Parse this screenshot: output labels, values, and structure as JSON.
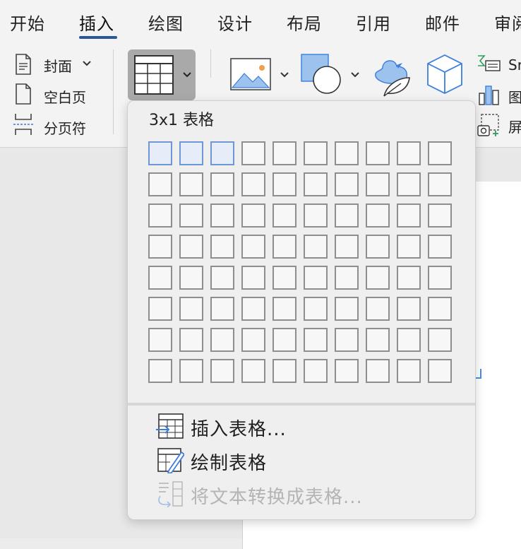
{
  "tabs": [
    {
      "label": "开始",
      "active": false
    },
    {
      "label": "插入",
      "active": true
    },
    {
      "label": "绘图",
      "active": false
    },
    {
      "label": "设计",
      "active": false
    },
    {
      "label": "布局",
      "active": false
    },
    {
      "label": "引用",
      "active": false
    },
    {
      "label": "邮件",
      "active": false
    },
    {
      "label": "审阅",
      "active": false
    }
  ],
  "ribbon": {
    "pages_group": {
      "cover": "封面",
      "blank_page": "空白页",
      "page_break": "分页符"
    },
    "right_group": {
      "smartart": "Sr",
      "chart": "图",
      "screenshot": "屏"
    },
    "icons": [
      "cover-page-icon",
      "blank-page-icon",
      "page-break-icon",
      "table-icon",
      "pictures-icon",
      "shapes-icon",
      "icons-icon",
      "3d-models-icon",
      "smartart-icon",
      "chart-icon",
      "screenshot-icon"
    ]
  },
  "table_dropdown": {
    "title": "3x1 表格",
    "grid_rows": 8,
    "grid_cols": 10,
    "selected_cols": 3,
    "selected_rows": 1,
    "menu": [
      {
        "label": "插入表格...",
        "enabled": true,
        "icon": "insert-table-icon"
      },
      {
        "label": "绘制表格",
        "enabled": true,
        "icon": "draw-table-icon"
      },
      {
        "label": "将文本转换成表格...",
        "enabled": false,
        "icon": "convert-text-to-table-icon"
      }
    ]
  },
  "colors": {
    "accent": "#2b579a",
    "selected_cell_border": "#6f96d6",
    "selected_cell_fill": "#e6edf8",
    "icon_blue": "#3d7ddb"
  }
}
